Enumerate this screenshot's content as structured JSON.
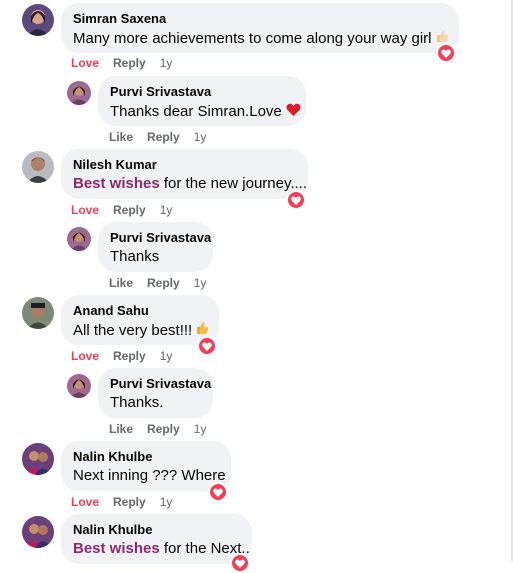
{
  "comments": [
    {
      "name": "Simran Saxena",
      "text": "Many more achievements to come along your way girl",
      "reaction_label": "Love",
      "reply_label": "Reply",
      "time": "1y",
      "reply": {
        "name": "Purvi Srivastava",
        "text": "Thanks dear Simran.Love",
        "like_label": "Like",
        "reply_label": "Reply",
        "time": "1y"
      }
    },
    {
      "name": "Nilesh Kumar",
      "highlight": "Best wishes",
      "text": " for the new journey....",
      "reaction_label": "Love",
      "reply_label": "Reply",
      "time": "1y",
      "reply": {
        "name": "Purvi Srivastava",
        "text": "Thanks",
        "like_label": "Like",
        "reply_label": "Reply",
        "time": "1y"
      }
    },
    {
      "name": "Anand Sahu",
      "text": "All the very best!!!",
      "reaction_label": "Love",
      "reply_label": "Reply",
      "time": "1y",
      "reply": {
        "name": "Purvi Srivastava",
        "text": "Thanks.",
        "like_label": "Like",
        "reply_label": "Reply",
        "time": "1y"
      }
    },
    {
      "name": "Nalin Khulbe",
      "text": "Next inning ??? Where",
      "reaction_label": "Love",
      "reply_label": "Reply",
      "time": "1y"
    },
    {
      "name": "Nalin Khulbe",
      "highlight": "Best wishes",
      "text": " for the Next.."
    }
  ],
  "colors": {
    "bubble": "#f0f2f5",
    "love": "#f33e58",
    "meta": "#65676b",
    "highlight": "#8a2a73"
  },
  "icons": {
    "love_reaction": "heart-icon",
    "thumbs_up_emoji": "thumbs-up-emoji-icon",
    "red_heart_emoji": "red-heart-emoji-icon"
  }
}
